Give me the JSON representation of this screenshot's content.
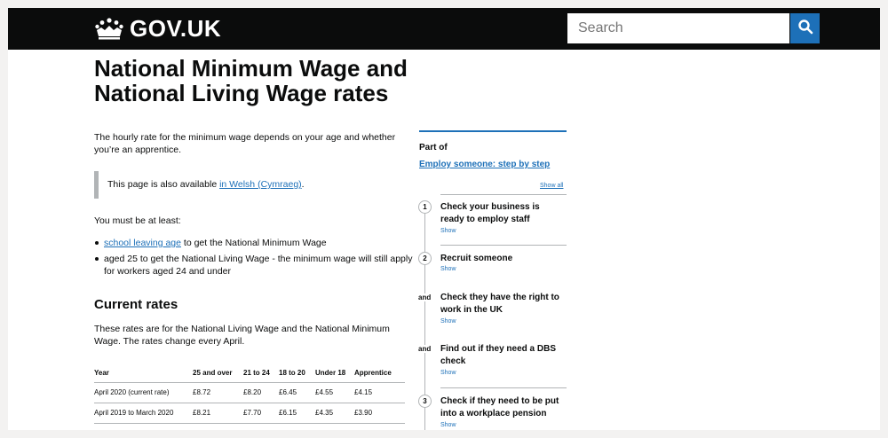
{
  "header": {
    "logo_text": "GOV.UK",
    "search_placeholder": "Search"
  },
  "page": {
    "title": "National Minimum Wage and National Living Wage rates",
    "intro": "The hourly rate for the minimum wage depends on your age and whether you’re an apprentice.",
    "inset_prefix": "This page is also available ",
    "inset_link": "in Welsh (Cymraeg)",
    "inset_suffix": ".",
    "must_be": "You must be at least:",
    "bullet1_link": "school leaving age",
    "bullet1_text": " to get the National Minimum Wage",
    "bullet2_text": "aged 25 to get the National Living Wage - the minimum wage will still apply for workers aged 24 and under",
    "current_rates_heading": "Current rates",
    "rates_desc": "These rates are for the National Living Wage and the National Minimum Wage. The rates change every April."
  },
  "table": {
    "headers": [
      "Year",
      "25 and over",
      "21 to 24",
      "18 to 20",
      "Under 18",
      "Apprentice"
    ],
    "rows": [
      [
        "April 2020 (current rate)",
        "£8.72",
        "£8.20",
        "£6.45",
        "£4.55",
        "£4.15"
      ],
      [
        "April 2019 to March 2020",
        "£8.21",
        "£7.70",
        "£6.15",
        "£4.35",
        "£3.90"
      ]
    ]
  },
  "sidebar": {
    "part_of": "Part of",
    "step_link": "Employ someone: step by step",
    "show_all": "Show all",
    "steps": [
      {
        "marker": "1",
        "title": "Check your business is ready to employ staff",
        "show": "Show"
      },
      {
        "marker": "2",
        "title": "Recruit someone",
        "show": "Show"
      },
      {
        "marker": "and",
        "title": "Check they have the right to work in the UK",
        "show": "Show"
      },
      {
        "marker": "and",
        "title": "Find out if they need a DBS check",
        "show": "Show"
      },
      {
        "marker": "3",
        "title": "Check if they need to be put into a workplace pension",
        "show": "Show"
      }
    ]
  },
  "colors": {
    "header_bg": "#0b0c0c",
    "link": "#1d70b8",
    "search_button": "#1d70b8",
    "border": "#b1b4b6"
  }
}
